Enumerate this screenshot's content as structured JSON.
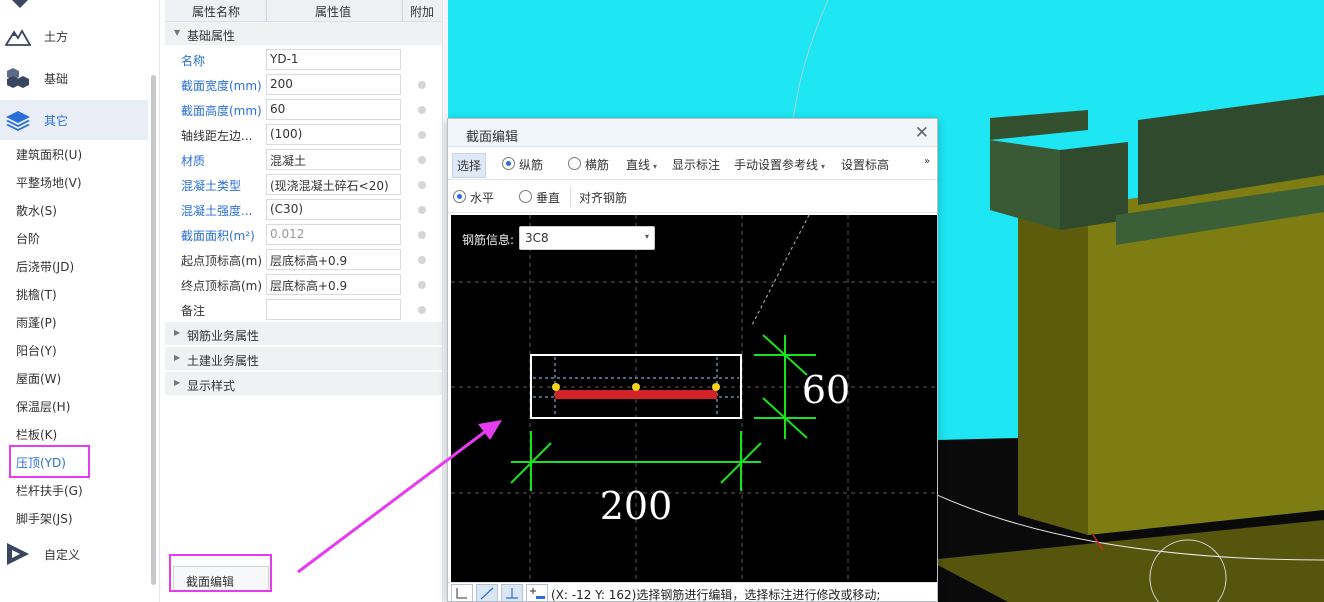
{
  "nav": {
    "categories": [
      {
        "label": "土方",
        "icon": "mountain-icon"
      },
      {
        "label": "基础",
        "icon": "cubes-icon"
      },
      {
        "label": "其它",
        "icon": "layers-icon"
      }
    ],
    "sub_items": [
      "建筑面积(U)",
      "平整场地(V)",
      "散水(S)",
      "台阶",
      "后浇带(JD)",
      "挑檐(T)",
      "雨蓬(P)",
      "阳台(Y)",
      "屋面(W)",
      "保温层(H)",
      "栏板(K)",
      "压顶(YD)",
      "栏杆扶手(G)",
      "脚手架(JS)"
    ],
    "custom": {
      "label": "自定义",
      "icon": "play-custom-icon"
    },
    "selected_item": "压顶(YD)"
  },
  "props": {
    "headers": {
      "name": "属性名称",
      "value": "属性值",
      "extra": "附加"
    },
    "group_basic": "基础属性",
    "rows": [
      {
        "name": "名称",
        "value": "YD-1",
        "style": "blue"
      },
      {
        "name": "截面宽度(mm)",
        "value": "200",
        "style": "blue"
      },
      {
        "name": "截面高度(mm)",
        "value": "60",
        "style": "blue"
      },
      {
        "name": "轴线距左边...",
        "value": "(100)",
        "style": "dark"
      },
      {
        "name": "材质",
        "value": "混凝土",
        "style": "blue"
      },
      {
        "name": "混凝土类型",
        "value": "(现浇混凝土碎石<20)",
        "style": "blue"
      },
      {
        "name": "混凝土强度...",
        "value": "(C30)",
        "style": "blue"
      },
      {
        "name": "截面面积(m²)",
        "value": "0.012",
        "style": "blue"
      },
      {
        "name": "起点顶标高(m)",
        "value": "层底标高+0.9",
        "style": "dark"
      },
      {
        "name": "终点顶标高(m)",
        "value": "层底标高+0.9",
        "style": "dark"
      },
      {
        "name": "备注",
        "value": "",
        "style": "dark"
      }
    ],
    "group_rebar": "钢筋业务属性",
    "group_civil": "土建业务属性",
    "group_display": "显示样式",
    "section_edit_button": "截面编辑"
  },
  "dialog": {
    "title": "截面编辑",
    "toolbar1": {
      "select": "选择",
      "longitudinal": "纵筋",
      "transverse": "横筋",
      "line": "直线",
      "show_dim": "显示标注",
      "manual_ref": "手动设置参考线",
      "set_elev": "设置标高",
      "more": "»"
    },
    "toolbar2": {
      "horizontal": "水平",
      "vertical": "垂直",
      "align": "对齐钢筋"
    },
    "rebar_info_label": "钢筋信息:",
    "rebar_info_value": "3C8",
    "dim_width": "200",
    "dim_height": "60",
    "status": "(X: -12 Y: 162)选择钢筋进行编辑，选择标注进行修改或移动;"
  },
  "colors": {
    "accent_blue": "#2b6fd6",
    "highlight_magenta": "#e63cf0",
    "viewport_cyan": "#1ee6f2",
    "dim_green": "#18e21c",
    "rebar_red": "#d2232a"
  }
}
